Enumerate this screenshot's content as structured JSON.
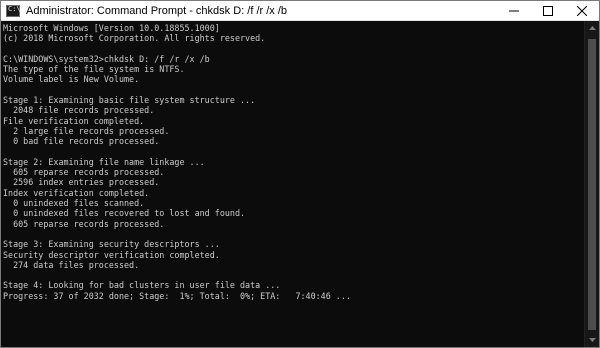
{
  "window": {
    "title": "Administrator: Command Prompt - chkdsk  D: /f /r /x /b",
    "icon_text": "C:\\"
  },
  "console": {
    "lines": [
      "Microsoft Windows [Version 10.0.18855.1000]",
      "(c) 2018 Microsoft Corporation. All rights reserved.",
      "",
      "C:\\WINDOWS\\system32>chkdsk D: /f /r /x /b",
      "The type of the file system is NTFS.",
      "Volume label is New Volume.",
      "",
      "Stage 1: Examining basic file system structure ...",
      "  2048 file records processed.",
      "File verification completed.",
      "  2 large file records processed.",
      "  0 bad file records processed.",
      "",
      "Stage 2: Examining file name linkage ...",
      "  605 reparse records processed.",
      "  2596 index entries processed.",
      "Index verification completed.",
      "  0 unindexed files scanned.",
      "  0 unindexed files recovered to lost and found.",
      "  605 reparse records processed.",
      "",
      "Stage 3: Examining security descriptors ...",
      "Security descriptor verification completed.",
      "  274 data files processed.",
      "",
      "Stage 4: Looking for bad clusters in user file data ...",
      "Progress: 37 of 2032 done; Stage:  1%; Total:  0%; ETA:   7:40:46 ..."
    ]
  },
  "colors": {
    "console_bg": "#0c0c0c",
    "console_fg": "#cccccc",
    "titlebar_bg": "#ffffff"
  }
}
